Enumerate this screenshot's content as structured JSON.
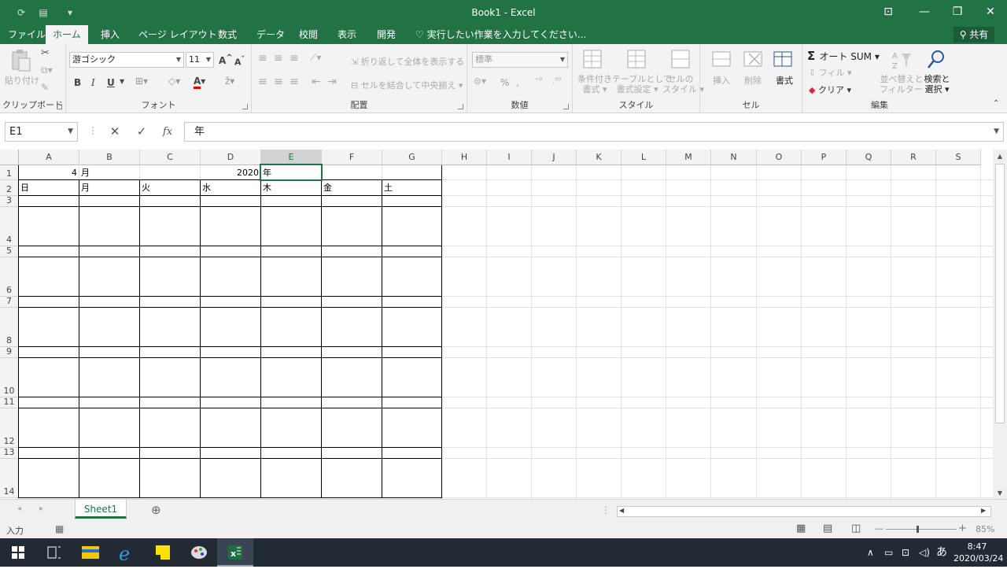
{
  "window": {
    "title": "Book1 - Excel"
  },
  "tabs": [
    "ファイル",
    "ホーム",
    "挿入",
    "ページ レイアウト",
    "数式",
    "データ",
    "校閲",
    "表示",
    "開発"
  ],
  "active_tab": "ホーム",
  "tell_me": "実行したい作業を入力してください...",
  "share": "共有",
  "ribbon": {
    "clipboard": {
      "label": "クリップボード",
      "paste": "貼り付け"
    },
    "font": {
      "label": "フォント",
      "name": "游ゴシック",
      "size": "11",
      "bold": "B",
      "italic": "I",
      "underline": "U",
      "grow": "A",
      "shrink": "A",
      "color_a": "A"
    },
    "alignment": {
      "label": "配置",
      "wrap": "折り返して全体を表示する",
      "merge": "セルを結合して中央揃え"
    },
    "number": {
      "label": "数値",
      "format": "標準",
      "percent": "%",
      "comma": ","
    },
    "styles": {
      "label": "スタイル",
      "conditional": [
        "条件付き",
        "書式"
      ],
      "table": [
        "テーブルとして",
        "書式設定"
      ],
      "cell": [
        "セルの",
        "スタイル"
      ]
    },
    "cells": {
      "label": "セル",
      "insert": "挿入",
      "delete": "削除",
      "format": "書式"
    },
    "editing": {
      "label": "編集",
      "autosum": "オート SUM",
      "fill": "フィル",
      "clear": "クリア",
      "sort": [
        "並べ替えと",
        "フィルター"
      ],
      "find": [
        "検索と",
        "選択"
      ]
    }
  },
  "formula_bar": {
    "name_box": "E1",
    "value": "年",
    "cancel": "✕",
    "enter": "✓",
    "fx": "fx"
  },
  "columns": [
    "A",
    "B",
    "C",
    "D",
    "E",
    "F",
    "G",
    "H",
    "I",
    "J",
    "K",
    "L",
    "M",
    "N",
    "O",
    "P",
    "Q",
    "R",
    "S"
  ],
  "selected_column": "E",
  "rows": [
    "1",
    "2",
    "3",
    "4",
    "5",
    "6",
    "7",
    "8",
    "9",
    "10",
    "11",
    "12",
    "13",
    "14"
  ],
  "cells": {
    "A1": "4",
    "B1": "月",
    "D1": "2020",
    "E1": "年",
    "A2": "日",
    "B2": "月",
    "C2": "火",
    "D2": "水",
    "E2": "木",
    "F2": "金",
    "G2": "土"
  },
  "sheet_tabs": [
    "Sheet1"
  ],
  "status": {
    "mode": "入力",
    "zoom": "85%"
  },
  "taskbar": {
    "time": "8:47",
    "date": "2020/03/24",
    "ime": "あ"
  },
  "colors": {
    "accent": "#217346"
  }
}
